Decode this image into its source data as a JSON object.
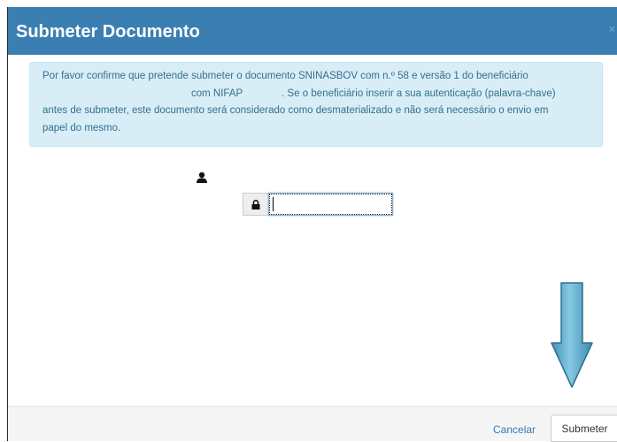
{
  "dialog": {
    "title": "Submeter Documento",
    "close_label": "×"
  },
  "alert": {
    "line1": "Por favor confirme que pretende submeter o documento SNINASBOV com n.º 58 e versão 1 do beneficiário",
    "line2a": "com NIFAP",
    "line2b": ". Se o beneficiário inserir a sua autenticação (palavra-chave)",
    "line3": "antes de submeter, este documento será considerado como desmaterializado e não será necessário o envio em",
    "line4": "papel do mesmo."
  },
  "form": {
    "user_icon": "user-icon",
    "lock_icon": "lock-icon",
    "password_value": ""
  },
  "overlay": {
    "arrow_icon": "arrow-down-icon",
    "arrow_color": "#6fb6d4"
  },
  "footer": {
    "cancel_label": "Cancelar",
    "submit_label": "Submeter"
  },
  "colors": {
    "header": "#3b7fb2",
    "alert_bg": "#d9edf7",
    "alert_text": "#31708f",
    "link": "#337ab7"
  }
}
